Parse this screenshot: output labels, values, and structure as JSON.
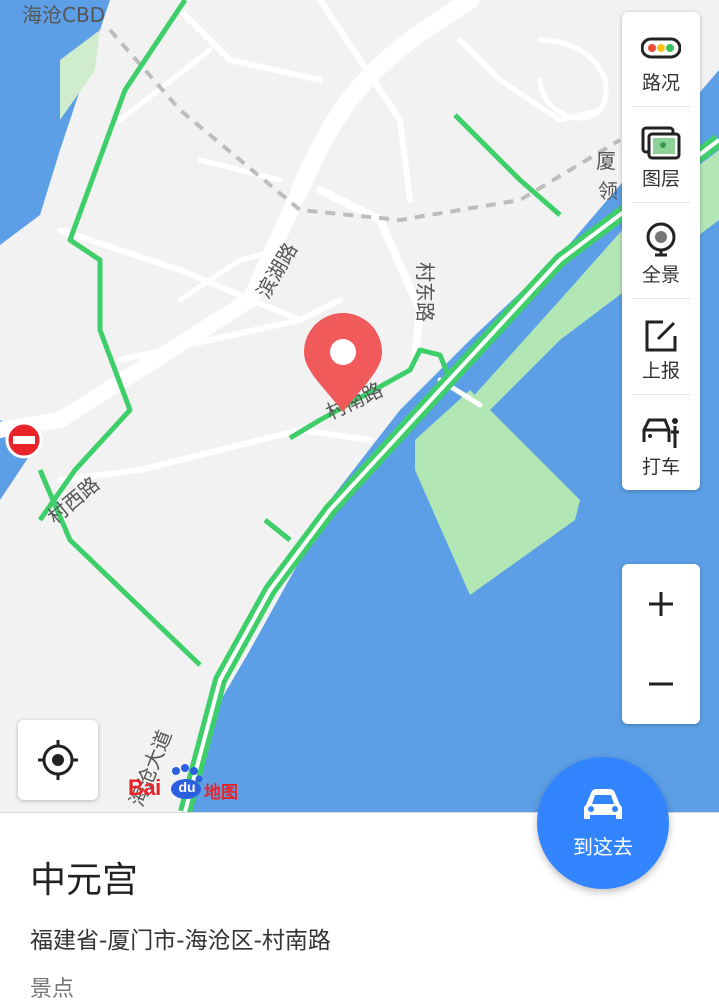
{
  "map": {
    "district_label": "海沧CBD",
    "roads": {
      "binhu": "滨湖路",
      "cundong": "村东路",
      "cunnan": "村南路",
      "cunxi": "村西路",
      "haicang_ave": "海沧大道",
      "xiamen_partial_1": "厦",
      "xiamen_partial_2": "领"
    },
    "traffic_color": "#3fcf6a",
    "water_color": "#5c9fe6",
    "green_color": "#b3e6b5",
    "land_color": "#f2f2f2",
    "marker_color": "#f05a5a"
  },
  "side_panel": {
    "items": [
      {
        "id": "traffic",
        "label": "路况",
        "icon": "traffic-light-icon"
      },
      {
        "id": "layers",
        "label": "图层",
        "icon": "layers-icon"
      },
      {
        "id": "panorama",
        "label": "全景",
        "icon": "panorama-pin-icon"
      },
      {
        "id": "report",
        "label": "上报",
        "icon": "edit-icon"
      },
      {
        "id": "taxi",
        "label": "打车",
        "icon": "taxi-icon"
      }
    ]
  },
  "zoom": {
    "in_label": "+",
    "out_label": "−"
  },
  "logo": {
    "bai": "Bai",
    "du": "du",
    "map": "地图"
  },
  "go_button": {
    "label": "到这去",
    "icon": "car-icon",
    "color": "#3385ff"
  },
  "place": {
    "name": "中元宫",
    "address": "福建省-厦门市-海沧区-村南路",
    "category": "景点"
  }
}
